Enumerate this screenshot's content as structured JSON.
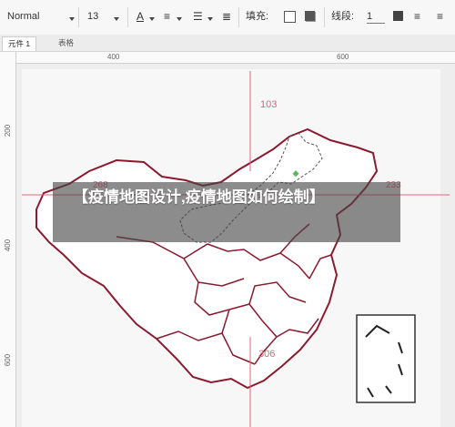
{
  "toolbar": {
    "font_family": "Normal",
    "font_size": "13",
    "fill_label": "填充:",
    "line_label": "线段:",
    "line_width": "1"
  },
  "tabs": [
    {
      "label": "元件 1",
      "active": true
    },
    {
      "label": "表格",
      "active": false
    }
  ],
  "ruler": {
    "top_labels": [
      "400",
      "600"
    ],
    "left_labels": [
      "200",
      "400",
      "600"
    ]
  },
  "guides": {
    "top_distance": "103",
    "left_distance": "268",
    "right_distance": "233",
    "bottom_distance": "306"
  },
  "banner": {
    "title": "【疫情地图设计,疫情地图如何绘制】"
  },
  "colors": {
    "guide": "#e2617a",
    "border": "#8b1a2e",
    "accent_node": "#5cb85c"
  }
}
